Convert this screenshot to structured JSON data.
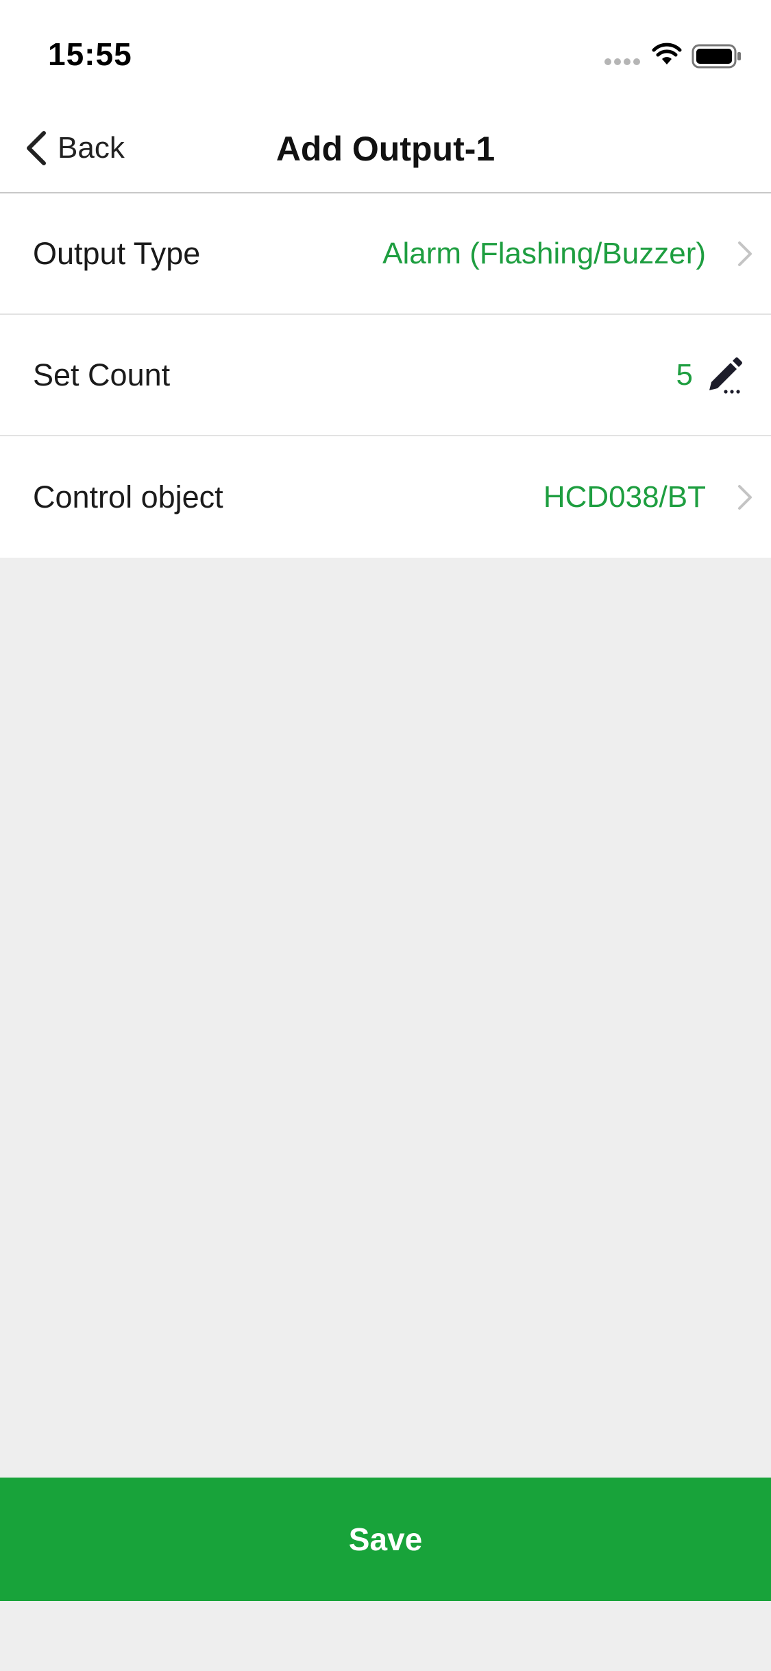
{
  "status_bar": {
    "time": "15:55",
    "icons": [
      "signal-icon",
      "wifi-icon",
      "battery-icon"
    ]
  },
  "nav": {
    "back_label": "Back",
    "title": "Add Output-1"
  },
  "rows": [
    {
      "label": "Output Type",
      "value": "Alarm (Flashing/Buzzer)",
      "accessory": "chevron-right-icon"
    },
    {
      "label": "Set Count",
      "value": "5",
      "accessory": "pencil-icon"
    },
    {
      "label": "Control object",
      "value": "HCD038/BT",
      "accessory": "chevron-right-icon"
    }
  ],
  "save_label": "Save",
  "colors": {
    "accent": "#18a33a",
    "value_text": "#1e9e40",
    "background": "#eeeeee"
  }
}
